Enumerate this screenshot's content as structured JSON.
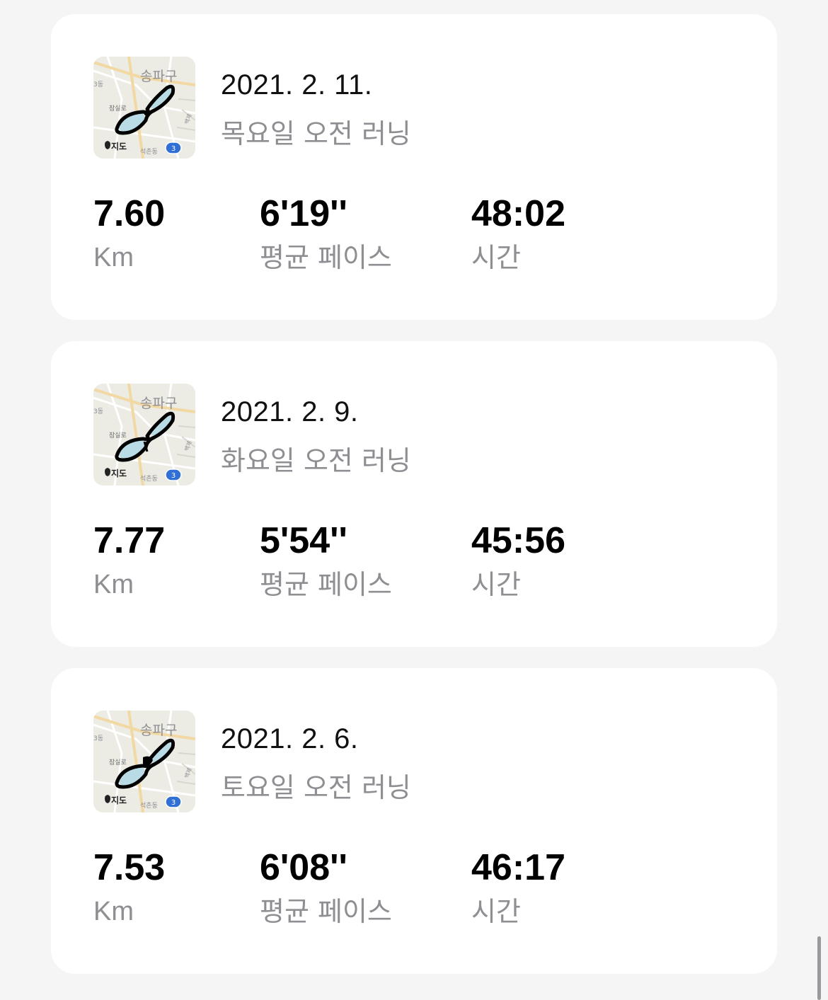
{
  "runs": [
    {
      "date": "2021. 2. 11.",
      "title": "목요일 오전 러닝",
      "distance": "7.60",
      "distance_unit": "Km",
      "pace": "6'19''",
      "pace_label": "평균 페이스",
      "time": "48:02",
      "time_label": "시간",
      "map": {
        "district": "송파구",
        "street": "잠실로",
        "top_left": "3동",
        "bottom": "석촌동",
        "brand": "지도",
        "route_badge": "3",
        "right_edge": "백제"
      }
    },
    {
      "date": "2021. 2. 9.",
      "title": "화요일 오전 러닝",
      "distance": "7.77",
      "distance_unit": "Km",
      "pace": "5'54''",
      "pace_label": "평균 페이스",
      "time": "45:56",
      "time_label": "시간",
      "map": {
        "district": "송파구",
        "street": "잠실로",
        "top_left": "3동",
        "bottom": "석촌동",
        "brand": "지도",
        "route_badge": "3",
        "right_edge": "백제"
      }
    },
    {
      "date": "2021. 2. 6.",
      "title": "토요일 오전 러닝",
      "distance": "7.53",
      "distance_unit": "Km",
      "pace": "6'08''",
      "pace_label": "평균 페이스",
      "time": "46:17",
      "time_label": "시간",
      "map": {
        "district": "송파구",
        "street": "잠실로",
        "top_left": "3동",
        "bottom": "석촌동",
        "brand": "지도",
        "route_badge": "3",
        "right_edge": "백제"
      }
    }
  ],
  "colors": {
    "card_bg": "#ffffff",
    "page_bg": "#f5f5f5",
    "label_gray": "#8e8e93",
    "lake_blue": "#b9dbe6",
    "route": "#000000",
    "badge_blue": "#2f6fd6"
  }
}
